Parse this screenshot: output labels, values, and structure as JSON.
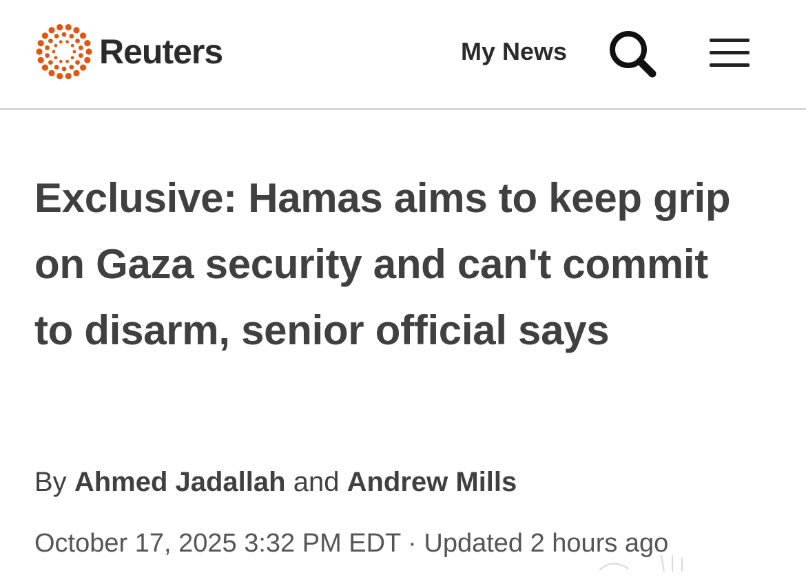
{
  "header": {
    "logo_text": "Reuters",
    "my_news_label": "My News",
    "search_icon": "search-icon",
    "menu_icon": "hamburger-menu-icon",
    "logo_color": "#e0560f"
  },
  "article": {
    "headline": "Exclusive: Hamas aims to keep grip on Gaza security and can't commit to disarm, senior official says",
    "byline_prefix": "By",
    "authors": [
      "Ahmed Jadallah",
      "Andrew Mills"
    ],
    "byline_conjunction": "and",
    "published": "October 17, 2025 3:32 PM EDT",
    "separator": "·",
    "updated": "Updated 2 hours ago"
  }
}
